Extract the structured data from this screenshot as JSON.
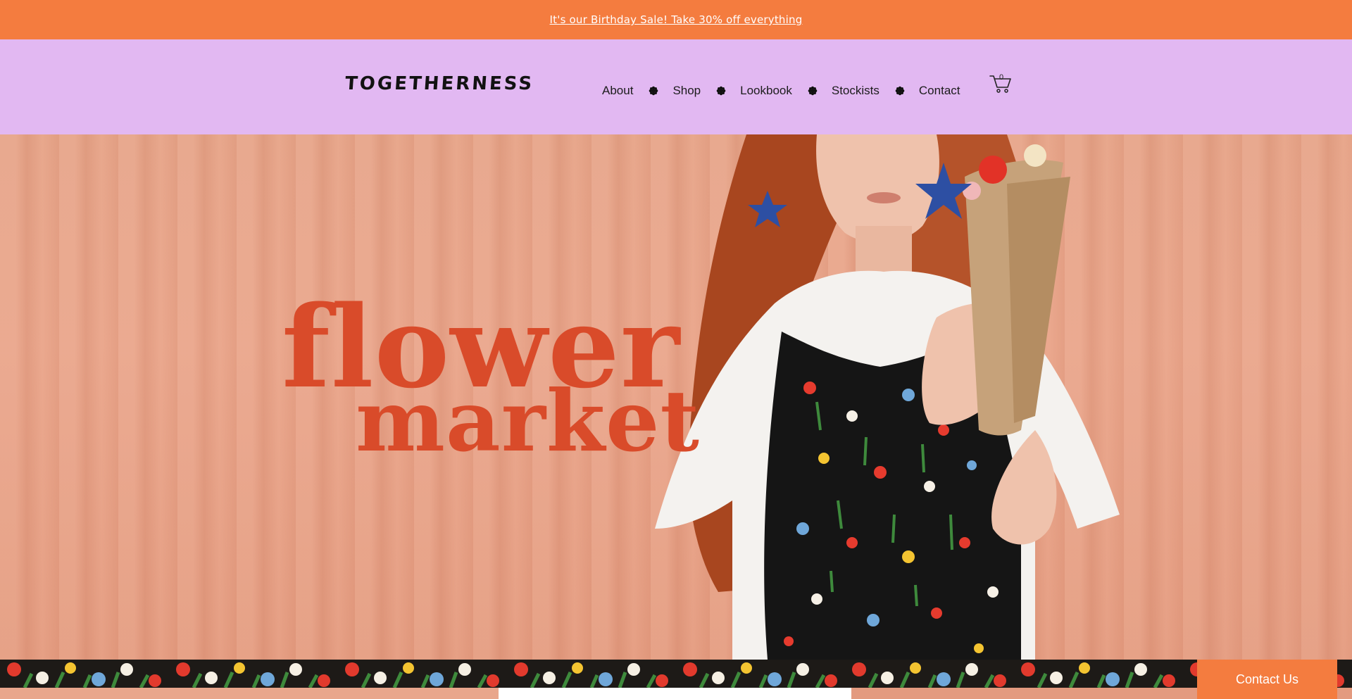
{
  "announcement": {
    "text": "It's our Birthday Sale! Take 30% off everything"
  },
  "header": {
    "logo": "TOGETHERNESS",
    "nav": [
      {
        "label": "About"
      },
      {
        "label": "Shop"
      },
      {
        "label": "Lookbook"
      },
      {
        "label": "Stockists"
      },
      {
        "label": "Contact"
      }
    ],
    "cart_count": "0"
  },
  "hero": {
    "line1": "flower",
    "line2": "market"
  },
  "contact_button": {
    "label": "Contact Us"
  },
  "colors": {
    "announcement_bg": "#f47c3f",
    "header_bg": "#e2b8f2",
    "hero_bg": "#e7a488",
    "hero_text": "#d94b2a",
    "contact_button_bg": "#f47c3f"
  },
  "icons": {
    "nav_separator": "flower-bullet-icon",
    "cart": "shopping-cart-icon"
  }
}
